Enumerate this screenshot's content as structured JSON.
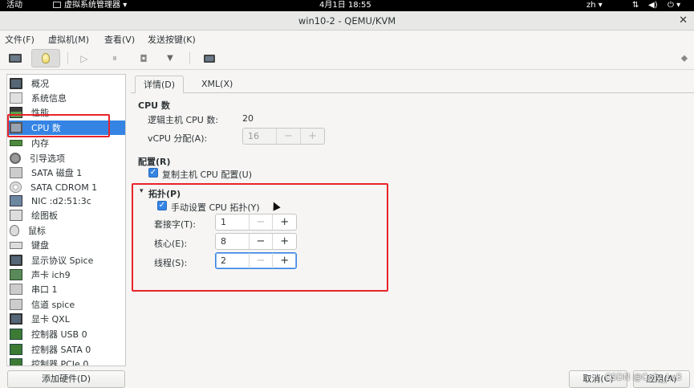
{
  "topbar": {
    "activities": "活动",
    "app_name": "虚拟系统管理器",
    "clock": "4月1日  18:55",
    "lang": "zh",
    "lang_caret": "▾",
    "app_caret": "▾",
    "power_caret": "▾"
  },
  "window": {
    "title": "win10-2 - QEMU/KVM",
    "close": "✕"
  },
  "menu": [
    "文件(F)",
    "虚拟机(M)",
    "查看(V)",
    "发送按键(K)"
  ],
  "sidebar": {
    "items": [
      {
        "label": "概况",
        "icon": "monitor-icon"
      },
      {
        "label": "系统信息",
        "icon": "info-icon"
      },
      {
        "label": "性能",
        "icon": "performance-icon"
      },
      {
        "label": "CPU 数",
        "icon": "cpu-icon"
      },
      {
        "label": "内存",
        "icon": "memory-icon"
      },
      {
        "label": "引导选项",
        "icon": "gear-icon"
      },
      {
        "label": "SATA 磁盘 1",
        "icon": "disk-icon"
      },
      {
        "label": "SATA CDROM 1",
        "icon": "cdrom-icon"
      },
      {
        "label": "NIC :d2:51:3c",
        "icon": "nic-icon"
      },
      {
        "label": "绘图板",
        "icon": "tablet-icon"
      },
      {
        "label": "鼠标",
        "icon": "mouse-icon"
      },
      {
        "label": "键盘",
        "icon": "keyboard-icon"
      },
      {
        "label": "显示协议 Spice",
        "icon": "display-icon"
      },
      {
        "label": "声卡 ich9",
        "icon": "sound-icon"
      },
      {
        "label": "串口 1",
        "icon": "serial-icon"
      },
      {
        "label": "信道 spice",
        "icon": "channel-icon"
      },
      {
        "label": "显卡 QXL",
        "icon": "video-icon"
      },
      {
        "label": "控制器 USB 0",
        "icon": "controller-icon"
      },
      {
        "label": "控制器 SATA 0",
        "icon": "controller-icon"
      },
      {
        "label": "控制器 PCIe 0",
        "icon": "controller-icon"
      }
    ],
    "selected_index": 3,
    "add_hardware": "添加硬件(D)"
  },
  "tabs": [
    {
      "label": "详情(D)"
    },
    {
      "label": "XML(X)"
    }
  ],
  "cpu_section": {
    "heading": "CPU 数",
    "host_cpu_label": "逻辑主机 CPU 数:",
    "host_cpu_value": "20",
    "vcpu_label": "vCPU 分配(A):",
    "vcpu_value": "16"
  },
  "config_section": {
    "heading": "配置(R)",
    "copy_host_label": "复制主机 CPU 配置(U)",
    "copy_host_checked": true
  },
  "topology_section": {
    "heading": "拓扑(P)",
    "expander": "▾",
    "manual_label": "手动设置 CPU 拓扑(Y)",
    "manual_checked": true,
    "sockets_label": "套接字(T):",
    "sockets_value": "1",
    "cores_label": "核心(E):",
    "cores_value": "8",
    "threads_label": "线程(S):",
    "threads_value": "2"
  },
  "spin": {
    "minus": "−",
    "plus": "+"
  },
  "buttons": {
    "cancel": "取消(C)",
    "apply": "应用(A)"
  },
  "watermark": "CSDN @Cofy_Lv3",
  "colors": {
    "accent": "#3584e4",
    "annotation_red": "#e8242a"
  }
}
